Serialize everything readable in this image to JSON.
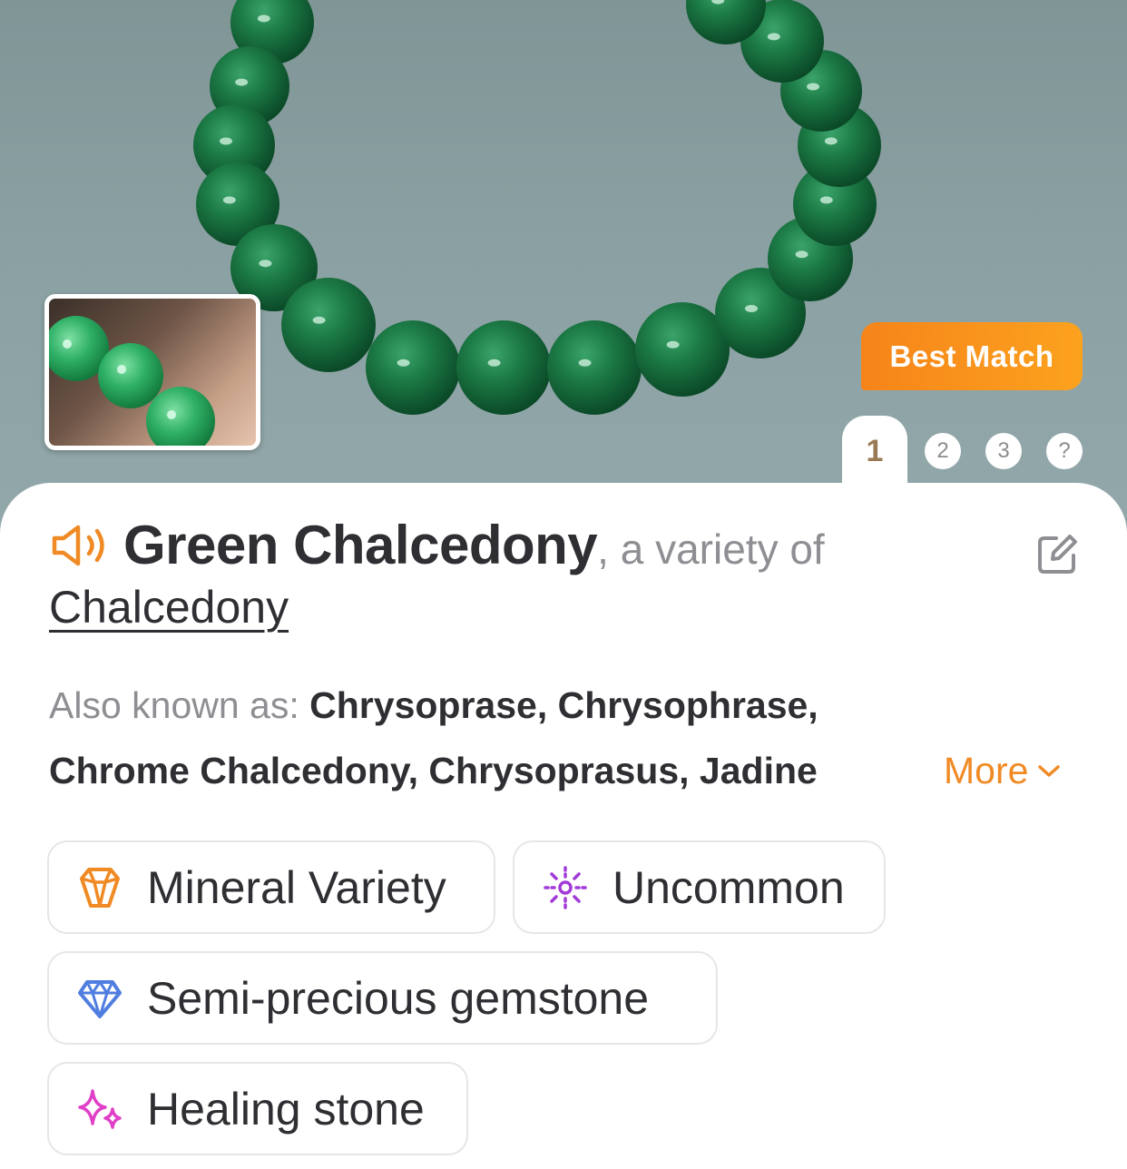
{
  "badge": {
    "label": "Best Match"
  },
  "pager": {
    "active": "1",
    "pages": [
      "2",
      "3",
      "?"
    ]
  },
  "title": {
    "name": "Green Chalcedony",
    "variety_prefix": ", a variety of",
    "parent": "Chalcedony"
  },
  "also_known": {
    "label": "Also known as:",
    "names_line1": "Chrysoprase, Chrysophrase,",
    "names_line2": "Chrome Chalcedony, Chrysoprasus, Jadine",
    "more_label": "More"
  },
  "tags": [
    {
      "label": "Mineral Variety",
      "icon": "crystal-icon",
      "color": "#f08a24"
    },
    {
      "label": "Uncommon",
      "icon": "sparkle-burst-icon",
      "color": "#a23ad8"
    },
    {
      "label": "Semi-precious gemstone",
      "icon": "diamond-icon",
      "color": "#4f7ee0"
    },
    {
      "label": "Healing stone",
      "icon": "sparkles-icon",
      "color": "#e040c8"
    }
  ]
}
